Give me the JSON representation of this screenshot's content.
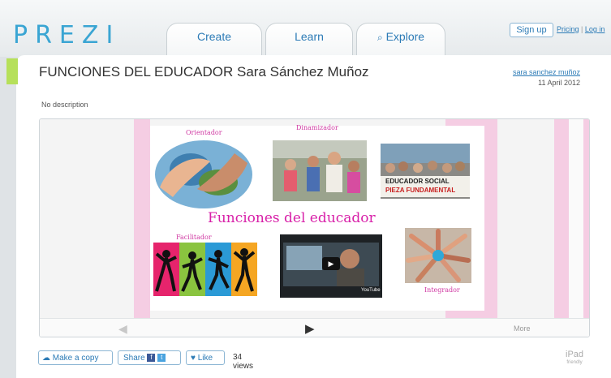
{
  "app": {
    "logo": "PREZI"
  },
  "nav": {
    "tabs": [
      {
        "label": "Create"
      },
      {
        "label": "Learn"
      },
      {
        "label": "Explore"
      }
    ],
    "sign_up": "Sign up",
    "pricing": "Pricing",
    "separator": "|",
    "login": "Log in"
  },
  "prezi": {
    "title": "FUNCIONES DEL EDUCADOR Sara Sánchez Muñoz",
    "description": "No description",
    "author": "sara sanchez muñoz",
    "date": "11 April 2012"
  },
  "slide": {
    "title": "Funciones del educador",
    "labels": {
      "orientador": "Orientador",
      "dinamizador": "Dinamizador",
      "facilitador": "Facilitador",
      "integrador": "Integrador"
    },
    "sign_text_1": "EDUCADOR SOCIAL",
    "sign_text_2": "PIEZA FUNDAMENTAL",
    "video_brand": "YouTube"
  },
  "viewer": {
    "more": "More"
  },
  "actions": {
    "make_copy": "Make a copy",
    "share": "Share",
    "like": "Like",
    "views": "34 views"
  },
  "badge": {
    "ipad": "iPad",
    "friendly": "friendly"
  },
  "colors": {
    "accent": "#2c7bb6",
    "pink": "#d81fa8",
    "stripe": "#f5cde3",
    "green": "#b6e05a"
  }
}
